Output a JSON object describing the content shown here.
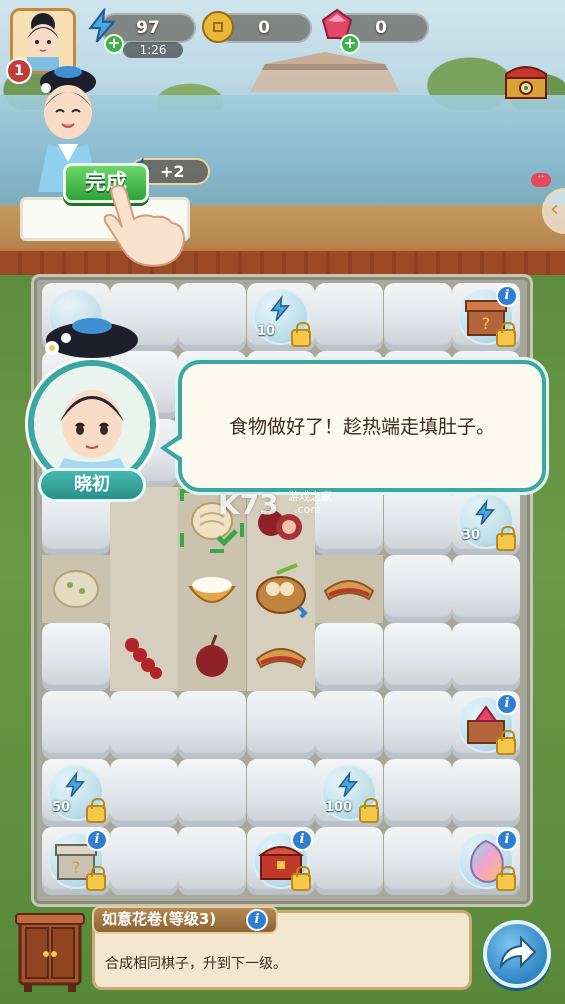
{
  "header": {
    "level": "1",
    "energy": {
      "value": "97",
      "timer": "1:26",
      "icon": "lightning-icon"
    },
    "coins": {
      "value": "0",
      "icon": "coin-icon"
    },
    "gems": {
      "value": "0",
      "icon": "ruby-icon"
    },
    "shop_icon": "treasure-chest-icon"
  },
  "order": {
    "done_label": "完成",
    "reward": "+2",
    "reward_icon": "lightning-icon"
  },
  "dialog": {
    "speaker_name": "晓初",
    "text": "食物做好了！趁热端走填肚子。"
  },
  "watermark": {
    "brand": "K73",
    "cn": "游戏之家",
    "domain": ".com"
  },
  "board": {
    "energy_bubbles": [
      {
        "amount": "10"
      },
      {
        "amount": "30"
      },
      {
        "amount": "50"
      },
      {
        "amount": "100"
      }
    ]
  },
  "bottom": {
    "item_title": "如意花卷(等级3)",
    "item_desc": "合成相同棋子，升到下一级。",
    "info_label": "i"
  },
  "colors": {
    "accent_teal": "#3aa7a0",
    "done_green": "#2ea33a",
    "info_blue": "#2f7fd1"
  }
}
